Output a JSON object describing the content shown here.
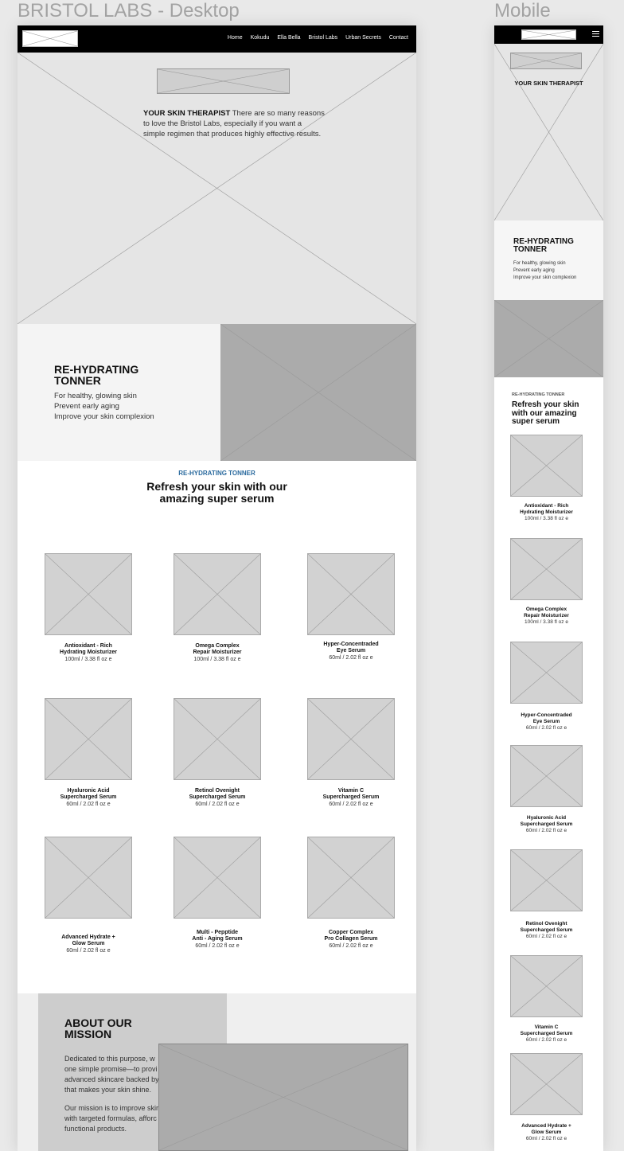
{
  "labels": {
    "desktop": "BRISTOL LABS - Desktop",
    "mobile": "Mobile"
  },
  "nav": {
    "items": [
      "Home",
      "Kokudu",
      "Ella Bella",
      "Bristol Labs",
      "Urban Secrets",
      "Contact"
    ]
  },
  "hero": {
    "title": "YOUR SKIN THERAPIST",
    "desktop_text": "There are so many reasons to love the Bristol Labs, especially if you want a simple regimen that produces highly effective results."
  },
  "tonner": {
    "title": "RE-HYDRATING TONNER",
    "bullets": [
      "For healthy, glowing skin",
      "Prevent early aging",
      "Improve your skin complexion"
    ]
  },
  "products_section": {
    "subtitle": "RE-HYDRATING TONNER",
    "title": "Refresh your skin with our amazing super serum"
  },
  "products": [
    {
      "name1": "Antioxidant - Rich",
      "name2": "Hydrating Moisturizer",
      "size": "100ml / 3.38 fl oz e"
    },
    {
      "name1": "Omega Complex",
      "name2": "Repair Moisturizer",
      "size": "100ml / 3.38 fl oz e"
    },
    {
      "name1": "Hyper-Concentraded",
      "name2": "Eye Serum",
      "size": "60ml / 2.02 fl oz e"
    },
    {
      "name1": "Hyaluronic Acid",
      "name2": "Supercharged Serum",
      "size": "60ml / 2.02 fl oz e"
    },
    {
      "name1": "Retinol Ovenight",
      "name2": "Supercharged Serum",
      "size": "60ml / 2.02 fl oz e"
    },
    {
      "name1": "Vitamin C",
      "name2": "Supercharged Serum",
      "size": "60ml / 2.02 fl oz e"
    },
    {
      "name1": "Advanced Hydrate +",
      "name2": "Glow Serum",
      "size": "60ml / 2.02 fl oz e"
    },
    {
      "name1": "Multi - Pepptide",
      "name2": "Anti - Aging Serum",
      "size": "60ml / 2.02 fl oz e"
    },
    {
      "name1": "Copper Complex",
      "name2": "Pro Collagen Serum",
      "size": "60ml / 2.02 fl oz e"
    }
  ],
  "mission": {
    "title": "ABOUT OUR MISSION",
    "p1_lines": [
      "Dedicated to this purpose, w",
      "one simple promise—to provi",
      "advanced skincare backed by",
      "that makes your skin shine."
    ],
    "p2_lines": [
      "Our mission is to improve skir",
      "with targeted formulas, afforc",
      "functional products."
    ]
  }
}
